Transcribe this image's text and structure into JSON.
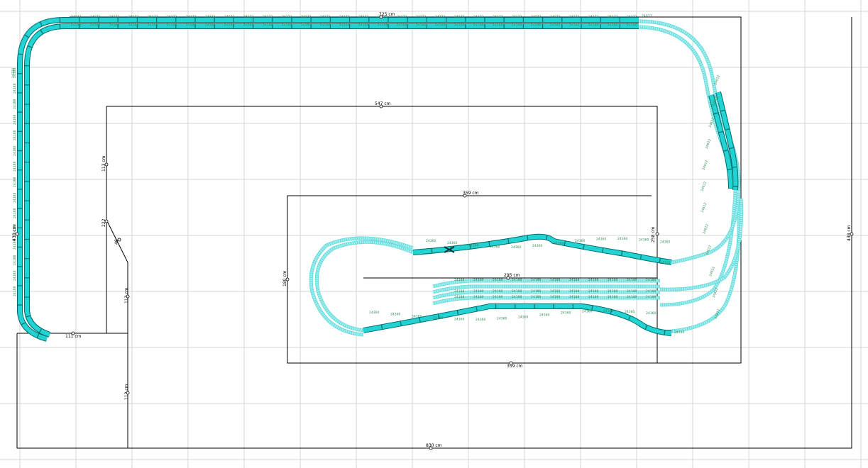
{
  "colors": {
    "grid": "#d4d4d4",
    "outline": "#000000",
    "track_fill": "#22d3d3",
    "track_edge": "#006b6b",
    "track_ghost": "#a8eeee",
    "label": "#2e8b57"
  },
  "dimensions": {
    "outer_width": "725 cm",
    "outer_bottom": "830 cm",
    "outer_right": "438 cm",
    "outer_left": "438 cm",
    "middle_width": "547 cm",
    "middle_left": "113 cm",
    "left_diagonal_a": "222",
    "left_diagonal_b": "48",
    "left_lower": "113 cm",
    "left_bottom_step": "111 cm",
    "left_below": "113 cm",
    "inner_width": "359 cm",
    "inner_height": "180 cm",
    "inner_right": "258 cm",
    "inner_bottom": "359 cm",
    "yard_width": "295 cm"
  },
  "track_codes": {
    "top_outer": "24172",
    "top_inner": "24188",
    "left": "24188",
    "curve": "24330",
    "yard": "24188",
    "loop": "24360",
    "small": "24612",
    "switch": "24077"
  },
  "icons": {
    "dimension_marker": "dimension-handle-icon",
    "turnout": "turnout-symbol-icon"
  }
}
